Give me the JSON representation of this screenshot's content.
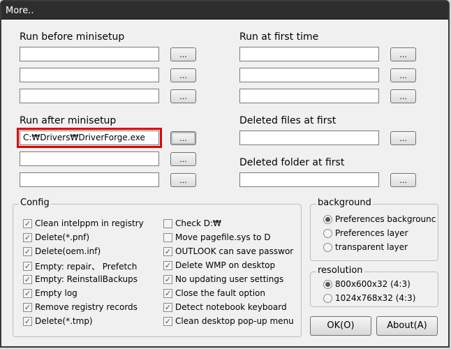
{
  "window": {
    "title": "More.."
  },
  "left": {
    "run_before_label": "Run before minisetup",
    "run_before": [
      "",
      "",
      ""
    ],
    "run_after_label": "Run after minisetup",
    "run_after": [
      "C:₩Drivers₩DriverForge.exe",
      "",
      ""
    ],
    "browse_label": "..."
  },
  "right": {
    "run_first_label": "Run at first time",
    "run_first": [
      "",
      "",
      ""
    ],
    "deleted_files_label": "Deleted files at first",
    "deleted_files": "",
    "deleted_folder_label": "Deleted folder at first",
    "deleted_folder": ""
  },
  "config": {
    "label": "Config",
    "items": [
      {
        "label": "Clean intelppm in registry",
        "checked": true
      },
      {
        "label": "Delete(*.pnf)",
        "checked": true
      },
      {
        "label": "Delete(oem.inf)",
        "checked": true
      },
      {
        "label": "Empty: repair、 Prefetch",
        "checked": true
      },
      {
        "label": "Empty: ReinstallBackups",
        "checked": true
      },
      {
        "label": "Empty log",
        "checked": true
      },
      {
        "label": "Remove registry records",
        "checked": true
      },
      {
        "label": "Delete(*.tmp)",
        "checked": true
      },
      {
        "label": "Check D:₩",
        "checked": false
      },
      {
        "label": "Move pagefile.sys to D",
        "checked": false
      },
      {
        "label": "OUTLOOK can save passwor",
        "checked": true
      },
      {
        "label": "Delete WMP on desktop",
        "checked": true
      },
      {
        "label": "No updating user settings",
        "checked": true
      },
      {
        "label": "Close the fault option",
        "checked": true
      },
      {
        "label": "Detect notebook keyboard",
        "checked": true
      },
      {
        "label": "Clean desktop pop-up menu",
        "checked": true
      }
    ]
  },
  "background": {
    "label": "background",
    "options": [
      "Preferences backgrounc",
      "Preferences layer",
      "transparent layer"
    ],
    "selected": 0
  },
  "resolution": {
    "label": "resolution",
    "options": [
      "800x600x32  (4:3)",
      "1024x768x32 (4:3)"
    ],
    "selected": 0
  },
  "buttons": {
    "ok": "OK(O)",
    "about": "About(A)"
  },
  "colors": {
    "highlight": "#e00000",
    "titlebar": "#2e2e2e"
  }
}
